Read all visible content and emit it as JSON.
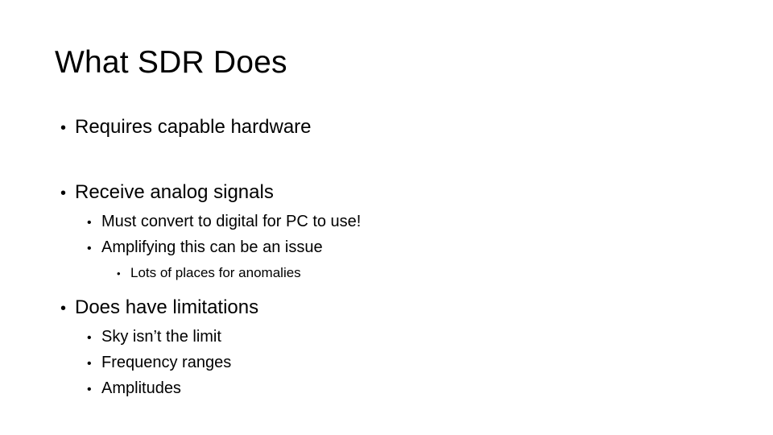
{
  "slide": {
    "title": "What SDR Does",
    "bullet_marker": "•",
    "text_color": "#000000",
    "background_color": "#ffffff",
    "content": [
      {
        "level": 1,
        "text": "Requires capable hardware"
      },
      {
        "level": 0,
        "text": ""
      },
      {
        "level": 1,
        "text": "Receive analog signals"
      },
      {
        "level": 2,
        "text": "Must convert to digital for PC to use!"
      },
      {
        "level": 2,
        "text": "Amplifying this can be an issue"
      },
      {
        "level": 3,
        "text": "Lots of places for anomalies"
      },
      {
        "level": 1,
        "text": "Does have limitations"
      },
      {
        "level": 2,
        "text": "Sky isn’t the limit"
      },
      {
        "level": 2,
        "text": "Frequency ranges"
      },
      {
        "level": 2,
        "text": "Amplitudes"
      }
    ]
  }
}
